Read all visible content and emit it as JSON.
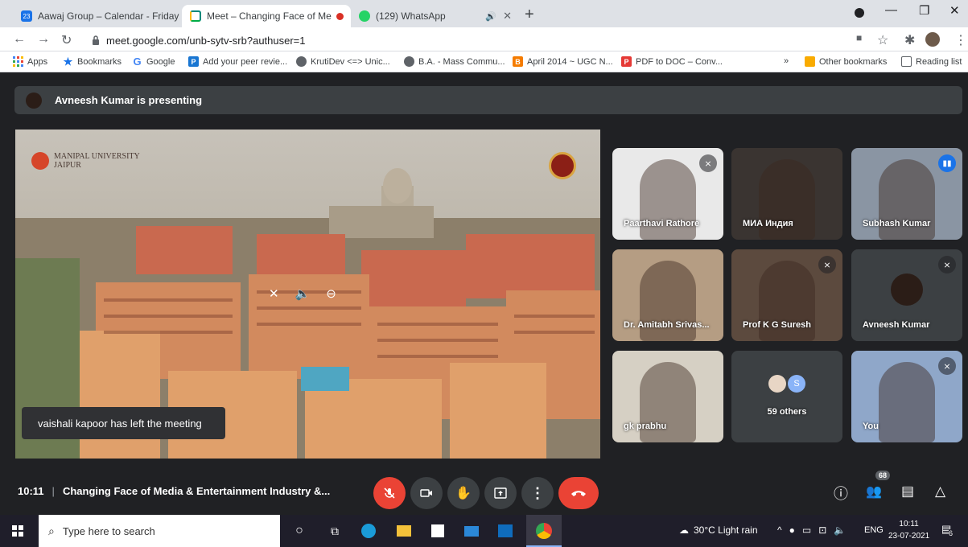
{
  "browser": {
    "tabs": [
      {
        "title": "Aawaj Group – Calendar - Friday",
        "favicon": "calendar-icon",
        "color": "#1a73e8",
        "badge": "23"
      },
      {
        "title": "Meet – Changing Face of Me",
        "favicon": "meet-icon",
        "color": "#00897b"
      },
      {
        "title": "(129) WhatsApp",
        "favicon": "whatsapp-icon",
        "color": "#25d366",
        "badge": "129"
      }
    ],
    "url": "meet.google.com/unb-sytv-srb?authuser=1",
    "bookmarks": [
      {
        "label": "Apps",
        "icon": "apps-icon",
        "color": "#4285f4"
      },
      {
        "label": "Bookmarks",
        "icon": "star-icon",
        "color": "#1a73e8"
      },
      {
        "label": "Google",
        "icon": "google-icon",
        "color": "#4285f4",
        "glyph": "G"
      },
      {
        "label": "Add your peer revie...",
        "icon": "p-icon",
        "color": "#1976d2",
        "glyph": "P"
      },
      {
        "label": "KrutiDev <=> Unic...",
        "icon": "globe-icon",
        "color": "#5f6368"
      },
      {
        "label": "B.A. - Mass Commu...",
        "icon": "globe-icon",
        "color": "#5f6368"
      },
      {
        "label": "April 2014 ~ UGC N...",
        "icon": "blogger-icon",
        "color": "#f57c00",
        "glyph": "B"
      },
      {
        "label": "PDF to DOC – Conv...",
        "icon": "pdf-icon",
        "color": "#e53935",
        "glyph": "P"
      }
    ],
    "overflow": "»",
    "other_bookmarks": "Other bookmarks",
    "reading_list": "Reading list"
  },
  "meet": {
    "presenting_banner": "Avneesh Kumar is presenting",
    "presentation": {
      "university": "MANIPAL UNIVERSITY",
      "campus": "JAIPUR"
    },
    "participants": [
      {
        "name": "Paarthavi Rathore",
        "muted": true,
        "bg": "#e9e9e9"
      },
      {
        "name": "МИА Индия",
        "muted": false,
        "bg": "#3a3431"
      },
      {
        "name": "Subhash Kumar",
        "muted": false,
        "speaking": true,
        "bg": "#8a95a3"
      },
      {
        "name": "Dr. Amitabh Srivas...",
        "muted": false,
        "bg": "#b59d83"
      },
      {
        "name": "Prof K G Suresh",
        "muted": true,
        "bg": "#5c4a3e"
      },
      {
        "name": "Avneesh Kumar",
        "muted": true,
        "bg": "#3c4043"
      },
      {
        "name": "gk prabhu",
        "muted": false,
        "bg": "#d6d0c4"
      },
      {
        "name": "59 others",
        "muted": false,
        "bg": "#3c4043"
      },
      {
        "name": "You",
        "muted": true,
        "bg": "#8fa7c9"
      }
    ],
    "others_avatar_letter": "S",
    "toast": "vaishali kapoor has left the meeting",
    "time": "10:11",
    "meeting_title": "Changing Face of Media & Entertainment Industry &...",
    "people_count": "68"
  },
  "taskbar": {
    "search_placeholder": "Type here to search",
    "weather": "30°C  Light rain",
    "lang": "ENG",
    "clock_time": "10:11",
    "clock_date": "23-07-2021",
    "notif_count": "6"
  }
}
